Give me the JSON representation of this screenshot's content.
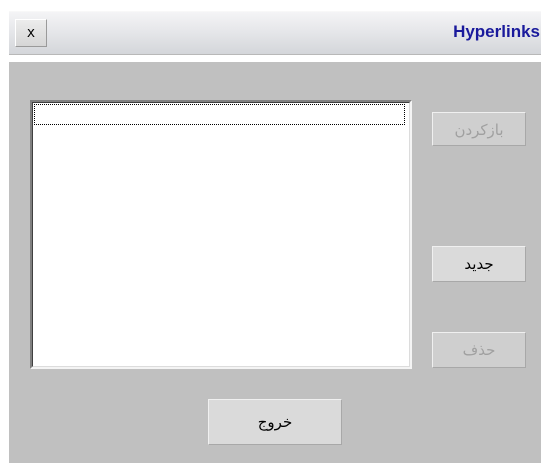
{
  "window": {
    "title": "Hyperlinks",
    "close_label": "x"
  },
  "buttons": {
    "undo_label": "بازکردن",
    "new_label": "جدید",
    "delete_label": "حذف",
    "exit_label": "خروج"
  },
  "list": {
    "items": []
  },
  "colors": {
    "title_text": "#1a1a9c",
    "dialog_bg": "#c0c0c0",
    "disabled_text": "#a0a0a0"
  }
}
